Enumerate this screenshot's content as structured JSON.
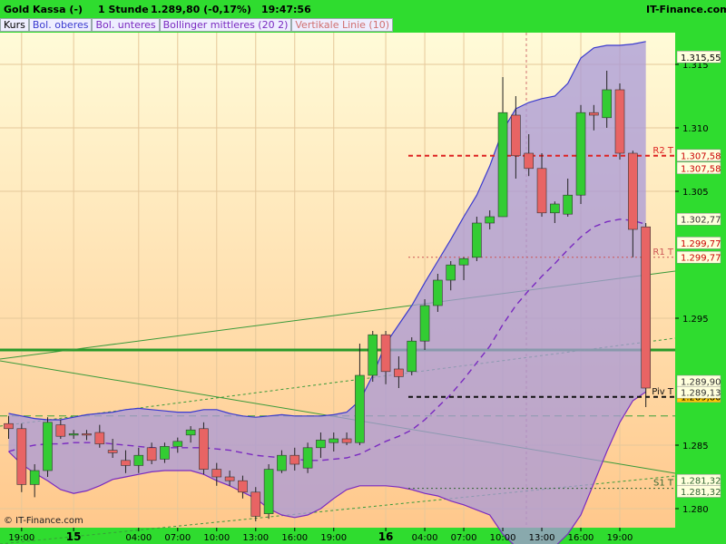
{
  "header": {
    "instrument": "Gold Kassa (-)",
    "interval": "1 Stunde",
    "price_change": "1.289,80 (-0,17%)",
    "time": "19:47:56",
    "brand": "IT-Finance.com"
  },
  "legend": [
    {
      "label": "Kurs",
      "color": "#000000"
    },
    {
      "label": "Bol. oberes",
      "color": "#3a3acf"
    },
    {
      "label": "Bol. unteres",
      "color": "#7a2ac0"
    },
    {
      "label": "Bollinger mittleres (20 2)",
      "color": "#7a2ac0"
    },
    {
      "label": "Vertikale Linie (10)",
      "color": "#d07070"
    }
  ],
  "copyright": "© IT-Finance.com",
  "colors": {
    "up": "#33cc33",
    "down": "#e86464",
    "band_fill": "#a898d8",
    "upper_band": "#3a3acf",
    "lower_band": "#7a2ac0",
    "middle_band": "#7a2ac0",
    "bg_top": "#fffad8",
    "bg_bottom": "#ffc890"
  },
  "chart_data": {
    "type": "candlestick",
    "ylim": [
      1.2785,
      1.3175
    ],
    "x_tick_labels": [
      {
        "label": "19:00",
        "index": 1,
        "bold": false
      },
      {
        "label": "15",
        "index": 5,
        "bold": true
      },
      {
        "label": "04:00",
        "index": 10,
        "bold": false
      },
      {
        "label": "07:00",
        "index": 13,
        "bold": false
      },
      {
        "label": "10:00",
        "index": 16,
        "bold": false
      },
      {
        "label": "13:00",
        "index": 19,
        "bold": false
      },
      {
        "label": "16:00",
        "index": 22,
        "bold": false
      },
      {
        "label": "19:00",
        "index": 25,
        "bold": false
      },
      {
        "label": "16",
        "index": 29,
        "bold": true
      },
      {
        "label": "04:00",
        "index": 32,
        "bold": false
      },
      {
        "label": "07:00",
        "index": 35,
        "bold": false
      },
      {
        "label": "10:00",
        "index": 38,
        "bold": false
      },
      {
        "label": "13:00",
        "index": 41,
        "bold": false
      },
      {
        "label": "16:00",
        "index": 44,
        "bold": false
      },
      {
        "label": "19:00",
        "index": 47,
        "bold": false
      }
    ],
    "y_ticks": [
      "1.280",
      "1.285",
      "1.295",
      "1.305",
      "1.310",
      "1.315"
    ],
    "y_tick_values": [
      1.28,
      1.285,
      1.295,
      1.305,
      1.31,
      1.315
    ],
    "candles": [
      {
        "o": 1.2867,
        "h": 1.2873,
        "l": 1.2855,
        "c": 1.2863
      },
      {
        "o": 1.2863,
        "h": 1.2867,
        "l": 1.2813,
        "c": 1.2819
      },
      {
        "o": 1.2819,
        "h": 1.2835,
        "l": 1.2809,
        "c": 1.283
      },
      {
        "o": 1.283,
        "h": 1.2872,
        "l": 1.2825,
        "c": 1.2868
      },
      {
        "o": 1.2866,
        "h": 1.287,
        "l": 1.2855,
        "c": 1.2857
      },
      {
        "o": 1.2858,
        "h": 1.2862,
        "l": 1.2855,
        "c": 1.2859
      },
      {
        "o": 1.2859,
        "h": 1.2862,
        "l": 1.2854,
        "c": 1.2858
      },
      {
        "o": 1.286,
        "h": 1.2866,
        "l": 1.2848,
        "c": 1.2851
      },
      {
        "o": 1.2846,
        "h": 1.2855,
        "l": 1.284,
        "c": 1.2844
      },
      {
        "o": 1.2838,
        "h": 1.2846,
        "l": 1.2828,
        "c": 1.2834
      },
      {
        "o": 1.2834,
        "h": 1.2848,
        "l": 1.2828,
        "c": 1.2842
      },
      {
        "o": 1.2848,
        "h": 1.2852,
        "l": 1.2835,
        "c": 1.2838
      },
      {
        "o": 1.2839,
        "h": 1.2852,
        "l": 1.2836,
        "c": 1.2849
      },
      {
        "o": 1.2849,
        "h": 1.2856,
        "l": 1.2844,
        "c": 1.2853
      },
      {
        "o": 1.2858,
        "h": 1.2865,
        "l": 1.2852,
        "c": 1.2862
      },
      {
        "o": 1.2863,
        "h": 1.2868,
        "l": 1.2827,
        "c": 1.2831
      },
      {
        "o": 1.2831,
        "h": 1.2836,
        "l": 1.2818,
        "c": 1.2825
      },
      {
        "o": 1.2825,
        "h": 1.283,
        "l": 1.2818,
        "c": 1.2822
      },
      {
        "o": 1.2822,
        "h": 1.2826,
        "l": 1.2808,
        "c": 1.2813
      },
      {
        "o": 1.2813,
        "h": 1.2817,
        "l": 1.279,
        "c": 1.2794
      },
      {
        "o": 1.2796,
        "h": 1.2835,
        "l": 1.2792,
        "c": 1.2831
      },
      {
        "o": 1.283,
        "h": 1.2846,
        "l": 1.2828,
        "c": 1.2842
      },
      {
        "o": 1.2842,
        "h": 1.2848,
        "l": 1.283,
        "c": 1.2835
      },
      {
        "o": 1.2832,
        "h": 1.2852,
        "l": 1.2828,
        "c": 1.2848
      },
      {
        "o": 1.2848,
        "h": 1.286,
        "l": 1.284,
        "c": 1.2854
      },
      {
        "o": 1.2852,
        "h": 1.286,
        "l": 1.2845,
        "c": 1.2855
      },
      {
        "o": 1.2855,
        "h": 1.286,
        "l": 1.285,
        "c": 1.2852
      },
      {
        "o": 1.2852,
        "h": 1.293,
        "l": 1.285,
        "c": 1.2905
      },
      {
        "o": 1.2905,
        "h": 1.294,
        "l": 1.29,
        "c": 1.2937
      },
      {
        "o": 1.2937,
        "h": 1.294,
        "l": 1.2898,
        "c": 1.2908
      },
      {
        "o": 1.291,
        "h": 1.292,
        "l": 1.2895,
        "c": 1.2904
      },
      {
        "o": 1.2908,
        "h": 1.2935,
        "l": 1.2905,
        "c": 1.2932
      },
      {
        "o": 1.2932,
        "h": 1.2965,
        "l": 1.2925,
        "c": 1.296
      },
      {
        "o": 1.296,
        "h": 1.2985,
        "l": 1.2955,
        "c": 1.298
      },
      {
        "o": 1.298,
        "h": 1.2995,
        "l": 1.2972,
        "c": 1.2992
      },
      {
        "o": 1.2992,
        "h": 1.2998,
        "l": 1.298,
        "c": 1.2997
      },
      {
        "o": 1.2998,
        "h": 1.303,
        "l": 1.2995,
        "c": 1.3025
      },
      {
        "o": 1.3025,
        "h": 1.3035,
        "l": 1.302,
        "c": 1.303
      },
      {
        "o": 1.303,
        "h": 1.314,
        "l": 1.303,
        "c": 1.3112
      },
      {
        "o": 1.311,
        "h": 1.3125,
        "l": 1.306,
        "c": 1.3078
      },
      {
        "o": 1.308,
        "h": 1.3095,
        "l": 1.3062,
        "c": 1.3068
      },
      {
        "o": 1.3068,
        "h": 1.308,
        "l": 1.303,
        "c": 1.3033
      },
      {
        "o": 1.3033,
        "h": 1.3042,
        "l": 1.3025,
        "c": 1.304
      },
      {
        "o": 1.3032,
        "h": 1.306,
        "l": 1.303,
        "c": 1.3047
      },
      {
        "o": 1.3047,
        "h": 1.3118,
        "l": 1.304,
        "c": 1.3112
      },
      {
        "o": 1.3112,
        "h": 1.3118,
        "l": 1.3098,
        "c": 1.311
      },
      {
        "o": 1.3108,
        "h": 1.3145,
        "l": 1.31,
        "c": 1.313
      },
      {
        "o": 1.313,
        "h": 1.3135,
        "l": 1.3075,
        "c": 1.308
      },
      {
        "o": 1.308,
        "h": 1.3082,
        "l": 1.2998,
        "c": 1.302
      },
      {
        "o": 1.3022,
        "h": 1.3025,
        "l": 1.288,
        "c": 1.2895
      }
    ],
    "upper_band": [
      1.2875,
      1.2873,
      1.2871,
      1.287,
      1.287,
      1.2872,
      1.2874,
      1.2875,
      1.2876,
      1.2878,
      1.2879,
      1.2878,
      1.2877,
      1.2876,
      1.2876,
      1.2878,
      1.2878,
      1.2875,
      1.2873,
      1.2872,
      1.2873,
      1.2874,
      1.2873,
      1.2873,
      1.2873,
      1.2874,
      1.2876,
      1.2885,
      1.2905,
      1.293,
      1.2945,
      1.296,
      1.2978,
      1.2995,
      1.3012,
      1.303,
      1.3047,
      1.307,
      1.3098,
      1.3115,
      1.312,
      1.3123,
      1.3125,
      1.3135,
      1.3155,
      1.3163,
      1.3165,
      1.3165,
      1.3166,
      1.3168
    ],
    "lower_band": [
      1.2845,
      1.2835,
      1.2828,
      1.2822,
      1.2815,
      1.2812,
      1.2814,
      1.2818,
      1.2823,
      1.2825,
      1.2827,
      1.2829,
      1.283,
      1.283,
      1.283,
      1.2827,
      1.2822,
      1.2818,
      1.2813,
      1.2808,
      1.28,
      1.2795,
      1.2793,
      1.2795,
      1.28,
      1.2808,
      1.2815,
      1.2818,
      1.2818,
      1.2818,
      1.2817,
      1.2815,
      1.2812,
      1.281,
      1.2806,
      1.2803,
      1.2799,
      1.2795,
      1.278,
      1.277,
      1.2768,
      1.2768,
      1.277,
      1.278,
      1.2795,
      1.282,
      1.2845,
      1.2868,
      1.2885,
      1.2892
    ],
    "middle_band": [
      1.2845,
      1.2848,
      1.285,
      1.2851,
      1.2851,
      1.2852,
      1.2852,
      1.2852,
      1.2851,
      1.285,
      1.2849,
      1.2848,
      1.2848,
      1.2848,
      1.2848,
      1.2848,
      1.2847,
      1.2846,
      1.2844,
      1.2842,
      1.2841,
      1.284,
      1.2839,
      1.2838,
      1.2838,
      1.2839,
      1.284,
      1.2843,
      1.2848,
      1.2853,
      1.2857,
      1.2862,
      1.287,
      1.288,
      1.289,
      1.2902,
      1.2915,
      1.2928,
      1.2945,
      1.296,
      1.2972,
      1.2983,
      1.2993,
      1.3004,
      1.3014,
      1.3022,
      1.3026,
      1.3028,
      1.3027,
      1.3024
    ],
    "horizontal_lines": [
      {
        "label": "R2 T",
        "value": 1.3078,
        "color": "#dd2222",
        "style": "dashed"
      },
      {
        "label": "R1 T",
        "value": 1.2998,
        "color": "#cc5555",
        "style": "dotted"
      },
      {
        "label": "Piv T",
        "value": 1.2888,
        "color": "#111111",
        "style": "dashed"
      },
      {
        "label": "S1 T",
        "value": 1.2816,
        "color": "#336633",
        "style": "dotted"
      }
    ],
    "price_labels": [
      {
        "text": "1.315,55",
        "value": 1.31555,
        "bg": "#ffffdd",
        "fg": "#000"
      },
      {
        "text": "1.307,58",
        "value": 1.3078,
        "bg": "#ffffdd",
        "fg": "#cc0000"
      },
      {
        "text": "1.307,58",
        "value": 1.3068,
        "bg": "#ffffdd",
        "fg": "#cc0000"
      },
      {
        "text": "1.302,77",
        "value": 1.30277,
        "bg": "#ffffdd",
        "fg": "#333"
      },
      {
        "text": "1.299,77",
        "value": 1.3009,
        "bg": "#ffffdd",
        "fg": "#cc0000"
      },
      {
        "text": "1.299,77",
        "value": 1.29977,
        "bg": "#ffffdd",
        "fg": "#cc0000"
      },
      {
        "text": "1.289,90",
        "value": 1.29,
        "bg": "#ffffdd",
        "fg": "#333"
      },
      {
        "text": "1.289,80",
        "value": 1.2888,
        "bg": "#ffcc00",
        "fg": "#000"
      },
      {
        "text": "1.289,13",
        "value": 1.28913,
        "bg": "#ffffdd",
        "fg": "#333"
      },
      {
        "text": "1.281,32",
        "value": 1.2822,
        "bg": "#ffffdd",
        "fg": "#336633"
      },
      {
        "text": "1.281,32",
        "value": 1.28132,
        "bg": "#ffffdd",
        "fg": "#336633"
      }
    ]
  }
}
